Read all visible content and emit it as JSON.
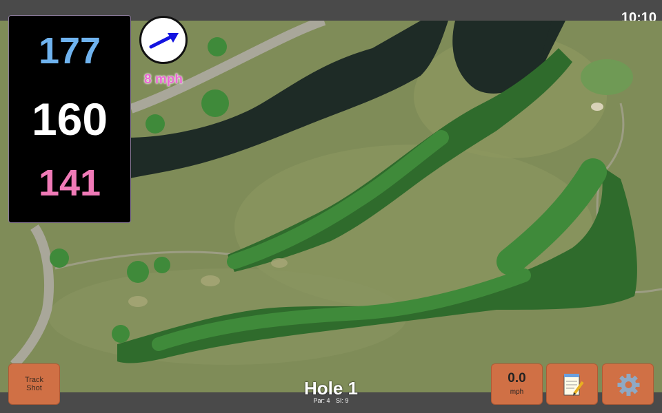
{
  "status_bar": {
    "time": "10:10"
  },
  "distances": {
    "back": "177",
    "middle": "160",
    "front": "141"
  },
  "wind": {
    "speed_label": "8 mph",
    "arrow_color": "#1414e0"
  },
  "hole": {
    "title": "Hole 1",
    "par_label": "Par: 4",
    "si_label": "SI: 9"
  },
  "buttons": {
    "track_shot_line1": "Track",
    "track_shot_line2": "Shot",
    "speed_value": "0.0",
    "speed_unit": "mph",
    "notes_icon": "notepad-icon",
    "settings_icon": "gear-icon"
  },
  "colors": {
    "button": "#d07045",
    "back_distance": "#6fb3ef",
    "front_distance": "#f07ab7",
    "wind_text": "#ea6ad3"
  }
}
